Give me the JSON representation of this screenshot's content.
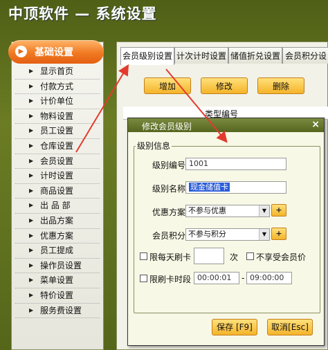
{
  "app": {
    "title": "中顶软件 — 系统设置"
  },
  "sidebar": {
    "header": "基础设置",
    "items": [
      "显示首页",
      "付款方式",
      "计价单位",
      "物料设置",
      "员工设置",
      "仓库设置",
      "会员设置",
      "计时设置",
      "商品设置",
      "出 品 部",
      "出品方案",
      "优惠方案",
      "员工提成",
      "操作员设置",
      "菜单设置",
      "特价设置",
      "服务费设置"
    ]
  },
  "tabs": [
    "会员级别设置",
    "计次计时设置",
    "储值折兑设置",
    "会员积分设"
  ],
  "toolbar": {
    "add": "增加",
    "edit": "修改",
    "delete": "删除"
  },
  "grid": {
    "col_header": "类型编号"
  },
  "dialog": {
    "title": "修改会员级别",
    "close": "×",
    "group_label": "级别信息",
    "level_code_label": "级别编号",
    "level_code_value": "1001",
    "level_name_label": "级别名称",
    "level_name_value": "现金储值卡",
    "discount_label": "优惠方案",
    "discount_value": "不参与优惠",
    "points_label": "会员积分",
    "points_value": "不参与积分",
    "daily_limit_label": "限每天刷卡",
    "daily_limit_unit": "次",
    "no_member_price_label": "不享受会员价",
    "time_limit_label": "限刷卡时段",
    "time_start": "00:00:01",
    "time_sep": "-",
    "time_end": "09:00:00",
    "save": "保存 [F9]",
    "cancel": "取消[Esc]",
    "plus": "+",
    "dropdown": "▼"
  },
  "colors": {
    "accent": "#f07a22",
    "annotation": "#e23b2e"
  }
}
